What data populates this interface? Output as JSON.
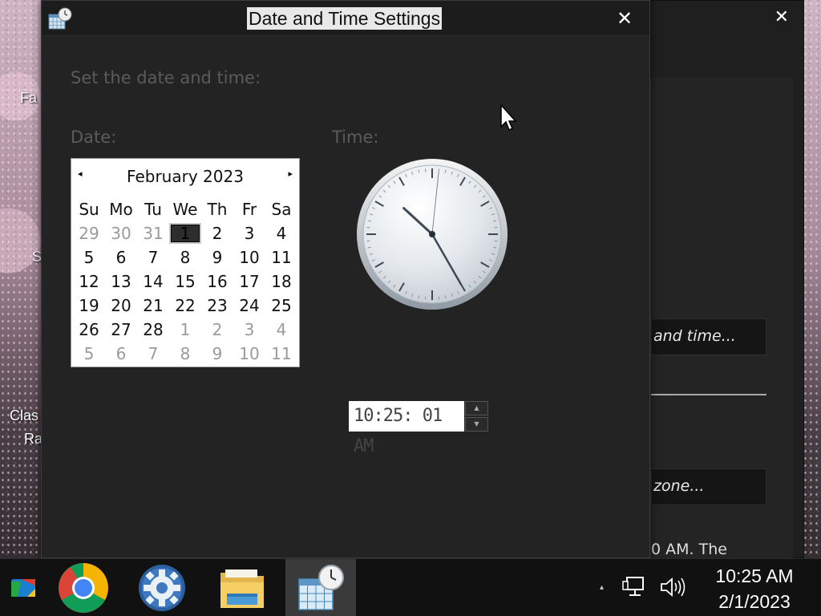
{
  "dialog": {
    "title": "Date and Time Settings",
    "close_glyph": "✕",
    "heading": "Set the date and time:",
    "date_label": "Date:",
    "time_label": "Time:"
  },
  "calendar": {
    "month_year": "February 2023",
    "prev_glyph": "◂",
    "next_glyph": "▸",
    "weekdays": [
      "Su",
      "Mo",
      "Tu",
      "We",
      "Th",
      "Fr",
      "Sa"
    ],
    "weeks": [
      [
        "29",
        "30",
        "31",
        "1",
        "2",
        "3",
        "4"
      ],
      [
        "5",
        "6",
        "7",
        "8",
        "9",
        "10",
        "11"
      ],
      [
        "12",
        "13",
        "14",
        "15",
        "16",
        "17",
        "18"
      ],
      [
        "19",
        "20",
        "21",
        "22",
        "23",
        "24",
        "25"
      ],
      [
        "26",
        "27",
        "28",
        "1",
        "2",
        "3",
        "4"
      ],
      [
        "5",
        "6",
        "7",
        "8",
        "9",
        "10",
        "11"
      ]
    ],
    "selected_day": "1"
  },
  "clock": {
    "hour": 10,
    "minute": 25,
    "second": 1
  },
  "time_picker": {
    "value": "10:25: 01 AM",
    "up_glyph": "▲",
    "down_glyph": "▼"
  },
  "back_window": {
    "close_glyph": "✕",
    "btn_time_label": "and time...",
    "btn_zone_label": "zone...",
    "text_fragment": "0 AM. The"
  },
  "desktop": {
    "label_1": "Fa",
    "label_2": "S",
    "label_3": "Clas",
    "label_4": "Ra"
  },
  "taskbar": {
    "apps": [
      "app-icon",
      "chrome-icon",
      "settings-icon",
      "file-explorer-icon",
      "date-time-icon"
    ],
    "tray_chevron": "▴",
    "clock_time": "10:25 AM",
    "clock_date": "2/1/2023"
  }
}
